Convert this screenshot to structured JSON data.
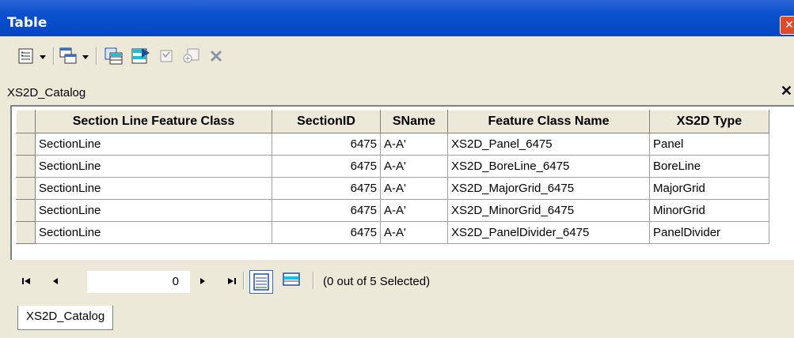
{
  "window": {
    "title": "Table"
  },
  "table_tab": {
    "name": "XS2D_Catalog"
  },
  "columns": [
    "Section Line Feature Class",
    "SectionID",
    "SName",
    "Feature Class Name",
    "XS2D Type"
  ],
  "rows": [
    [
      "SectionLine",
      "6475",
      "A-A'",
      "XS2D_Panel_6475",
      "Panel"
    ],
    [
      "SectionLine",
      "6475",
      "A-A'",
      "XS2D_BoreLine_6475",
      "BoreLine"
    ],
    [
      "SectionLine",
      "6475",
      "A-A'",
      "XS2D_MajorGrid_6475",
      "MajorGrid"
    ],
    [
      "SectionLine",
      "6475",
      "A-A'",
      "XS2D_MinorGrid_6475",
      "MinorGrid"
    ],
    [
      "SectionLine",
      "6475",
      "A-A'",
      "XS2D_PanelDivider_6475",
      "PanelDivider"
    ]
  ],
  "navigation": {
    "current_record": "0",
    "selection_status": "(0 out of 5 Selected)"
  },
  "bottom_tab": {
    "label": "XS2D_Catalog"
  },
  "colors": {
    "titlebar": "#0a50cc",
    "chrome": "#ece9d8",
    "close": "#e04a2a"
  },
  "icons": [
    "table-options-icon",
    "related-tables-icon",
    "select-by-attributes-icon",
    "switch-selection-icon",
    "clear-selection-icon",
    "zoom-to-selected-icon",
    "delete-selected-icon",
    "first-record-icon",
    "previous-record-icon",
    "next-record-icon",
    "last-record-icon",
    "show-all-records-icon",
    "show-selected-records-icon"
  ]
}
